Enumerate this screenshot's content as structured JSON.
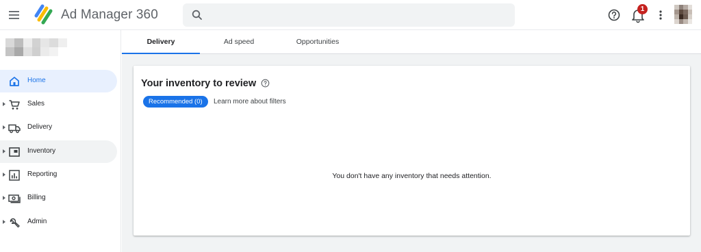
{
  "header": {
    "app_title": "Ad Manager 360",
    "search": {
      "placeholder": "",
      "value": ""
    },
    "notifications_count": "1",
    "colors": {
      "badge": "#c5221f",
      "logo_blue": "#4285f4",
      "logo_yellow": "#fbbc04",
      "logo_green": "#34a853"
    }
  },
  "sidebar": {
    "items": [
      {
        "label": "Home",
        "icon": "home-icon",
        "state": "active"
      },
      {
        "label": "Sales",
        "icon": "cart-icon",
        "state": "normal"
      },
      {
        "label": "Delivery",
        "icon": "truck-icon",
        "state": "normal"
      },
      {
        "label": "Inventory",
        "icon": "inventory-icon",
        "state": "hovered"
      },
      {
        "label": "Reporting",
        "icon": "bar-chart-icon",
        "state": "normal"
      },
      {
        "label": "Billing",
        "icon": "money-icon",
        "state": "normal"
      },
      {
        "label": "Admin",
        "icon": "wrench-icon",
        "state": "normal"
      }
    ]
  },
  "main": {
    "tabs": [
      {
        "label": "Delivery",
        "active": true
      },
      {
        "label": "Ad speed",
        "active": false
      },
      {
        "label": "Opportunities",
        "active": false
      }
    ],
    "card": {
      "title": "Your inventory to review",
      "filter_chip": "Recommended (0)",
      "learn_more": "Learn more about filters",
      "empty_message": "You don't have any inventory that needs attention."
    }
  },
  "colors": {
    "accent": "#1a73e8",
    "active_nav_bg": "#e8f0fe",
    "page_bg": "#f1f3f4"
  }
}
